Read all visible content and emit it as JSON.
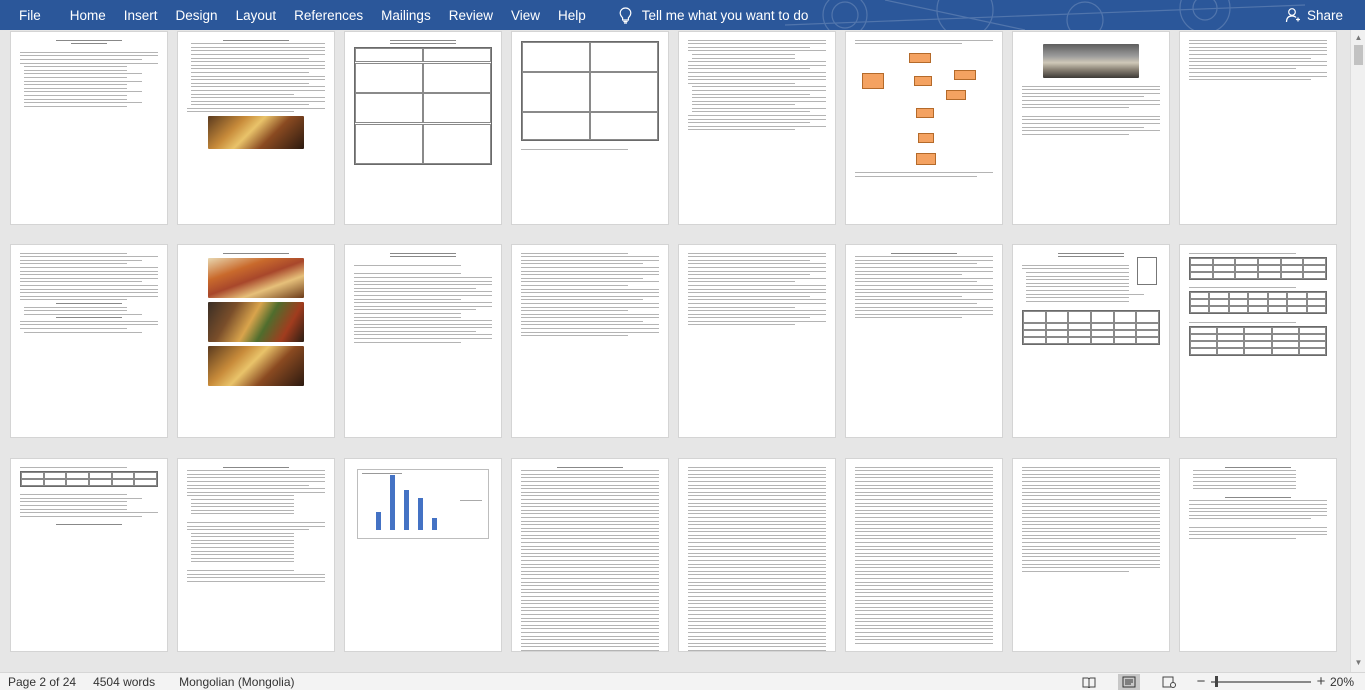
{
  "ribbon": {
    "tabs": [
      "File",
      "Home",
      "Insert",
      "Design",
      "Layout",
      "References",
      "Mailings",
      "Review",
      "View",
      "Help"
    ],
    "tell_me": "Tell me what you want to do",
    "share": "Share"
  },
  "status": {
    "page": "Page 2 of 24",
    "words": "4504 words",
    "language": "Mongolian (Mongolia)",
    "zoom": "20%",
    "zoom_level_percent": 20
  },
  "colors": {
    "ribbon": "#2b579a",
    "canvas": "#e6e6e6",
    "chart_bar": "#4472c4",
    "diagram_box": "#f4a261"
  }
}
